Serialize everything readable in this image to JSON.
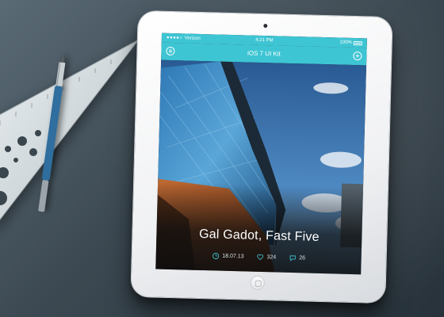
{
  "statusbar": {
    "carrier": "Verizon",
    "time": "4:21 PM",
    "battery": "100%"
  },
  "navbar": {
    "title": "iOS 7 UI Kit",
    "left_icon": "menu-icon",
    "right_icon": "add-icon"
  },
  "article": {
    "title": "Gal Gadot, Fast Five",
    "date": "18.07.13",
    "likes": "324",
    "comments": "26"
  },
  "colors": {
    "accent": "#3ec5d3",
    "desk": "#3c4952",
    "tablet_bezel": "#ffffff"
  }
}
